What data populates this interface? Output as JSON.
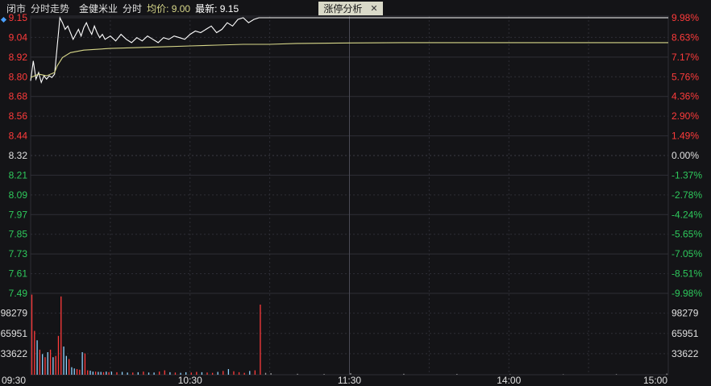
{
  "header": {
    "status": "闭市",
    "mode": "分时走势",
    "stock_name": "金健米业",
    "intraday_label": "分时",
    "avg_label": "均价: 9.00",
    "latest_label": "最新: 9.15",
    "tab_label": "涨停分析",
    "close_glyph": "✕"
  },
  "colors": {
    "background": "#141417",
    "grid": "#2e2e36",
    "up": "#ff3b3b",
    "down": "#2ec95c",
    "neutral": "#e0e0e0",
    "price_line": "#ffffff",
    "avg_line": "#d8d88a",
    "tab_bg": "#d9d9c8"
  },
  "chart_data": {
    "type": "line",
    "x_ticks": [
      "09:30",
      "10:30",
      "11:30",
      "14:00",
      "15:00"
    ],
    "price_ticks": [
      "9.15",
      "9.04",
      "8.92",
      "8.80",
      "8.68",
      "8.56",
      "8.44",
      "8.32",
      "8.21",
      "8.09",
      "7.97",
      "7.85",
      "7.73",
      "7.61",
      "7.49"
    ],
    "pct_ticks": [
      "9.98%",
      "8.63%",
      "7.17%",
      "5.76%",
      "4.36%",
      "2.90%",
      "1.49%",
      "0.00%",
      "-1.37%",
      "-2.78%",
      "-4.24%",
      "-5.65%",
      "-7.05%",
      "-8.51%",
      "-9.98%"
    ],
    "prev_close": 8.32,
    "ylim": [
      7.49,
      9.15
    ],
    "grid": true,
    "volume_ticks": [
      "98279",
      "65951",
      "33622"
    ],
    "volume_ylim": [
      0,
      130000
    ],
    "series": [
      {
        "name": "分时",
        "minutes": [
          0,
          1,
          2,
          3,
          4,
          5,
          6,
          7,
          8,
          9,
          10,
          11,
          12,
          13,
          14,
          15,
          16,
          17,
          18,
          19,
          20,
          21,
          22,
          23,
          24,
          25,
          26,
          27,
          28,
          30,
          32,
          34,
          36,
          38,
          40,
          42,
          44,
          46,
          48,
          50,
          52,
          54,
          56,
          58,
          60,
          62,
          64,
          66,
          68,
          70,
          72,
          74,
          76,
          78,
          80,
          82,
          84,
          86,
          88,
          90,
          92,
          95,
          100,
          110,
          120,
          130,
          140,
          150,
          160,
          170,
          180,
          190,
          200,
          210,
          220,
          230,
          240
        ],
        "values": [
          8.77,
          8.89,
          8.78,
          8.82,
          8.76,
          8.8,
          8.78,
          8.8,
          8.79,
          8.81,
          8.98,
          9.15,
          9.12,
          9.08,
          9.1,
          9.06,
          9.02,
          9.05,
          9.08,
          9.04,
          9.09,
          9.12,
          9.08,
          9.05,
          9.1,
          9.06,
          9.03,
          9.05,
          9.02,
          9.04,
          9.01,
          9.05,
          9.02,
          9.0,
          9.03,
          9.01,
          9.04,
          9.02,
          9.0,
          9.03,
          9.02,
          9.04,
          9.03,
          9.02,
          9.05,
          9.07,
          9.06,
          9.08,
          9.1,
          9.06,
          9.08,
          9.12,
          9.1,
          9.14,
          9.15,
          9.12,
          9.14,
          9.15,
          9.15,
          9.15,
          9.15,
          9.15,
          9.15,
          9.15,
          9.15,
          9.15,
          9.15,
          9.15,
          9.15,
          9.15,
          9.15,
          9.15,
          9.15,
          9.15,
          9.15,
          9.15,
          9.15
        ]
      },
      {
        "name": "均价",
        "minutes": [
          0,
          3,
          6,
          9,
          10,
          12,
          15,
          20,
          30,
          40,
          50,
          60,
          70,
          80,
          90,
          100,
          120,
          140,
          160,
          180,
          200,
          220,
          240
        ],
        "values": [
          8.79,
          8.81,
          8.8,
          8.82,
          8.86,
          8.91,
          8.94,
          8.955,
          8.965,
          8.97,
          8.975,
          8.98,
          8.985,
          8.99,
          8.99,
          8.995,
          8.998,
          9.0,
          9.0,
          9.0,
          9.0,
          9.0,
          9.0
        ]
      }
    ],
    "volume": {
      "minutes": [
        0,
        1,
        2,
        3,
        4,
        5,
        6,
        7,
        8,
        9,
        10,
        11,
        12,
        13,
        14,
        15,
        16,
        17,
        18,
        19,
        20,
        21,
        22,
        23,
        24,
        25,
        26,
        27,
        28,
        29,
        30,
        32,
        34,
        36,
        38,
        40,
        42,
        44,
        46,
        48,
        50,
        52,
        54,
        56,
        58,
        60,
        62,
        64,
        66,
        68,
        70,
        72,
        74,
        76,
        78,
        80,
        82,
        84,
        86,
        88,
        90,
        100,
        110,
        120,
        140,
        160,
        180,
        200,
        220,
        239
      ],
      "values": [
        128000,
        70000,
        55000,
        40000,
        33000,
        28000,
        36000,
        40000,
        28000,
        30000,
        62000,
        125000,
        45000,
        30000,
        25000,
        12000,
        10000,
        9000,
        8000,
        36000,
        34000,
        7000,
        6500,
        5000,
        5000,
        4500,
        4500,
        4000,
        5000,
        4000,
        5000,
        4000,
        4500,
        3500,
        3500,
        4000,
        5000,
        3500,
        3500,
        5000,
        7000,
        4000,
        3500,
        3000,
        4000,
        3500,
        4500,
        4000,
        3500,
        3000,
        4500,
        6000,
        9000,
        5500,
        4000,
        3000,
        6000,
        7000,
        112000,
        3000,
        2500,
        1500,
        1200,
        2500,
        1500,
        1200,
        800,
        700,
        900,
        1800
      ],
      "directions": [
        "up",
        "up",
        "down",
        "up",
        "down",
        "up",
        "down",
        "up",
        "down",
        "up",
        "up",
        "up",
        "down",
        "down",
        "up",
        "down",
        "down",
        "up",
        "up",
        "down",
        "up",
        "up",
        "down",
        "down",
        "up",
        "down",
        "down",
        "up",
        "down",
        "up",
        "down",
        "up",
        "down",
        "down",
        "up",
        "down",
        "up",
        "down",
        "down",
        "up",
        "up",
        "down",
        "up",
        "down",
        "down",
        "up",
        "up",
        "down",
        "up",
        "up",
        "down",
        "up",
        "down",
        "up",
        "up",
        "up",
        "down",
        "up",
        "up",
        "flat",
        "flat",
        "flat",
        "flat",
        "flat",
        "flat",
        "flat",
        "flat",
        "flat",
        "flat",
        "flat"
      ]
    }
  }
}
